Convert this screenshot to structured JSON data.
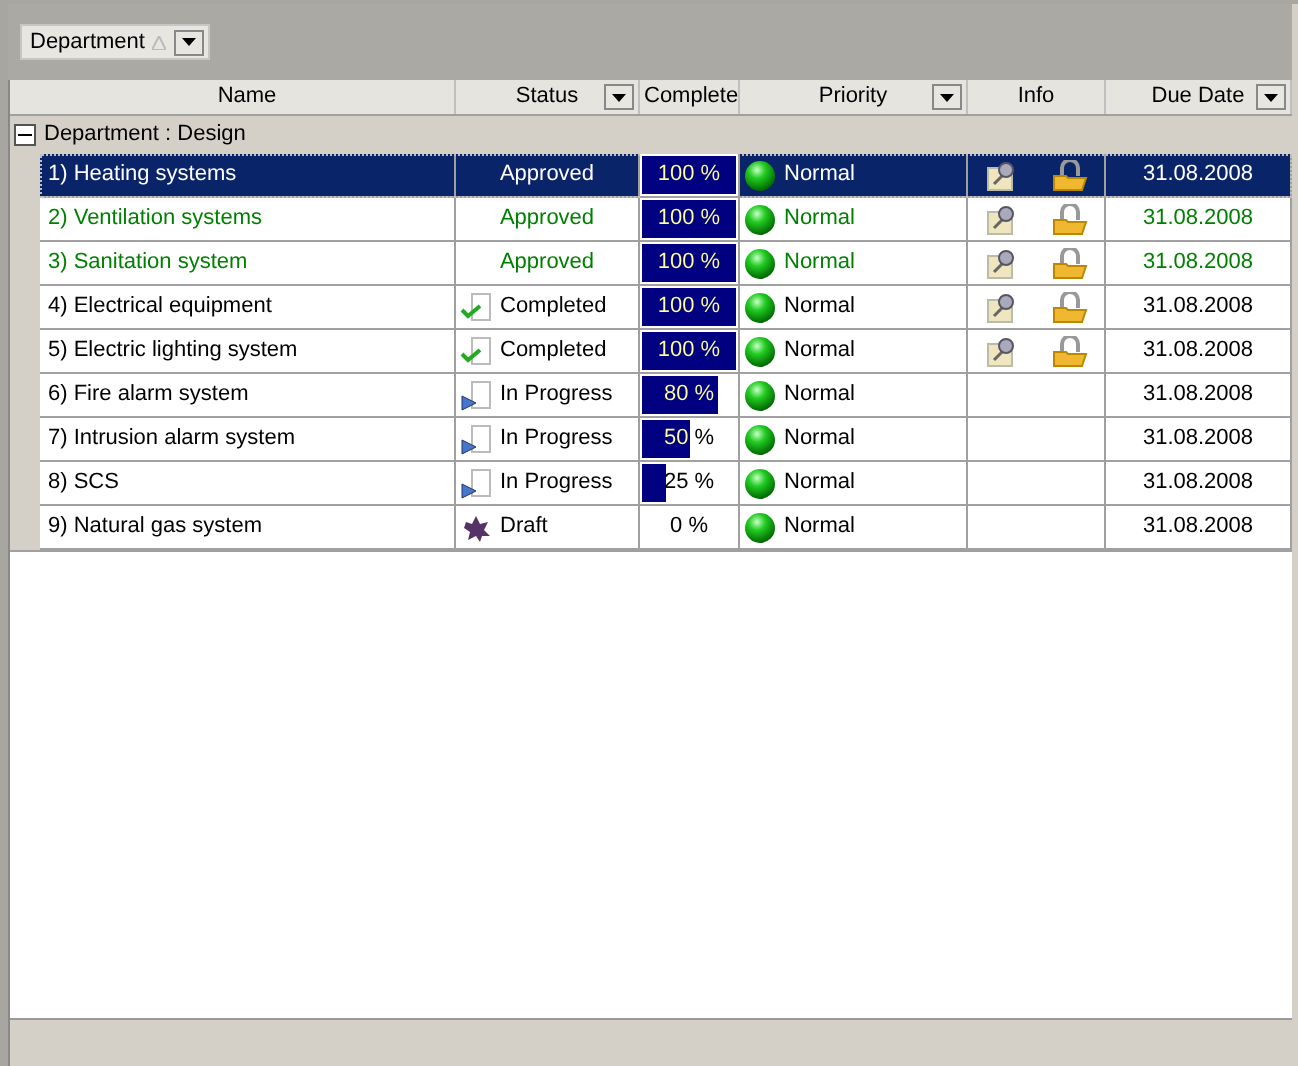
{
  "group_panel": {
    "chips": [
      {
        "label": "Department"
      }
    ]
  },
  "columns": [
    {
      "label": "Name",
      "filter": false
    },
    {
      "label": "Status",
      "filter": true
    },
    {
      "label": "Complete",
      "filter": false
    },
    {
      "label": "Priority",
      "filter": true
    },
    {
      "label": "Info",
      "filter": false
    },
    {
      "label": "Due Date",
      "filter": true
    }
  ],
  "group": {
    "label": "Department : Design",
    "expanded": true
  },
  "rows": [
    {
      "name": "1) Heating systems",
      "status": "Approved",
      "kind": "approved",
      "complete": "100 %",
      "level": 1,
      "priority": "Normal",
      "info": true,
      "due": "31.08.2008",
      "selected": true
    },
    {
      "name": "2) Ventilation systems",
      "status": "Approved",
      "kind": "approved",
      "complete": "100 %",
      "level": 1,
      "priority": "Normal",
      "info": true,
      "due": "31.08.2008",
      "selected": false
    },
    {
      "name": "3) Sanitation system",
      "status": "Approved",
      "kind": "approved",
      "complete": "100 %",
      "level": 1,
      "priority": "Normal",
      "info": true,
      "due": "31.08.2008",
      "selected": false
    },
    {
      "name": "4) Electrical equipment",
      "status": "Completed",
      "kind": "completed",
      "complete": "100 %",
      "level": 1,
      "priority": "Normal",
      "info": true,
      "due": "31.08.2008",
      "selected": false
    },
    {
      "name": "5) Electric lighting system",
      "status": "Completed",
      "kind": "completed",
      "complete": "100 %",
      "level": 1,
      "priority": "Normal",
      "info": true,
      "due": "31.08.2008",
      "selected": false
    },
    {
      "name": "6) Fire alarm system",
      "status": "In Progress",
      "kind": "in_progress",
      "complete": "80 %",
      "level": 0.8,
      "priority": "Normal",
      "info": false,
      "due": "31.08.2008",
      "selected": false
    },
    {
      "name": "7) Intrusion alarm system",
      "status": "In Progress",
      "kind": "in_progress",
      "complete": "50 %",
      "level": 0.5,
      "priority": "Normal",
      "info": false,
      "due": "31.08.2008",
      "selected": false
    },
    {
      "name": "8) SCS",
      "status": "In Progress",
      "kind": "in_progress",
      "complete": "25 %",
      "level": 0.25,
      "priority": "Normal",
      "info": false,
      "due": "31.08.2008",
      "selected": false
    },
    {
      "name": "9) Natural gas system",
      "status": "Draft",
      "kind": "draft",
      "complete": "0 %",
      "priority": "Normal",
      "info": false,
      "due": "31.08.2008",
      "selected": false
    }
  ]
}
